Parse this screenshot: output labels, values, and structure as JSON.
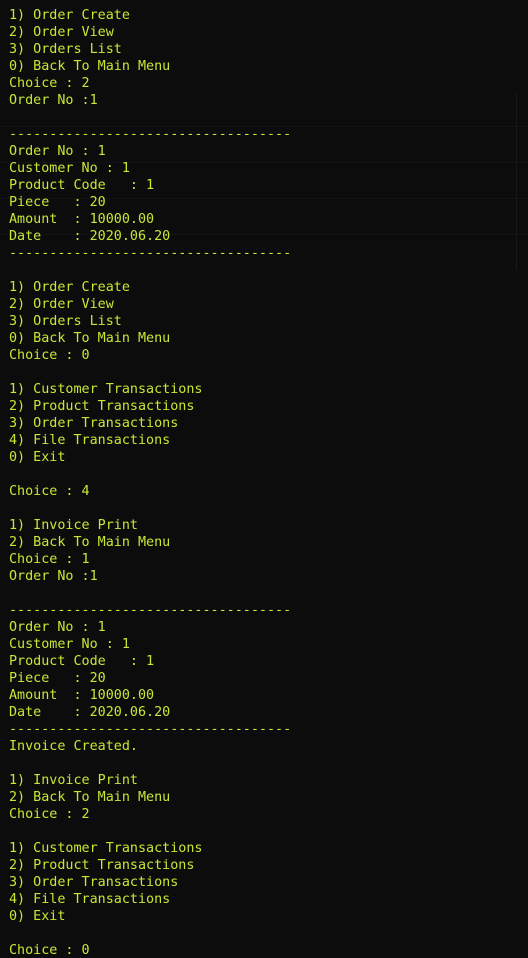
{
  "console": {
    "text_color": "#c6e835",
    "background_color": "#0c0c0c",
    "lines": [
      "1) Order Create",
      "2) Order View",
      "3) Orders List",
      "0) Back To Main Menu",
      "Choice : 2",
      "Order No :1",
      "",
      "-----------------------------------",
      "Order No : 1",
      "Customer No : 1",
      "Product Code   : 1",
      "Piece   : 20",
      "Amount  : 10000.00",
      "Date    : 2020.06.20",
      "-----------------------------------",
      "",
      "1) Order Create",
      "2) Order View",
      "3) Orders List",
      "0) Back To Main Menu",
      "Choice : 0",
      "",
      "1) Customer Transactions",
      "2) Product Transactions",
      "3) Order Transactions",
      "4) File Transactions",
      "0) Exit",
      "",
      "Choice : 4",
      "",
      "1) Invoice Print",
      "2) Back To Main Menu",
      "Choice : 1",
      "Order No :1",
      "",
      "-----------------------------------",
      "Order No : 1",
      "Customer No : 1",
      "Product Code   : 1",
      "Piece   : 20",
      "Amount  : 10000.00",
      "Date    : 2020.06.20",
      "-----------------------------------",
      "Invoice Created.",
      "",
      "1) Invoice Print",
      "2) Back To Main Menu",
      "Choice : 2",
      "",
      "1) Customer Transactions",
      "2) Product Transactions",
      "3) Order Transactions",
      "4) File Transactions",
      "0) Exit",
      "",
      "Choice : 0"
    ]
  }
}
